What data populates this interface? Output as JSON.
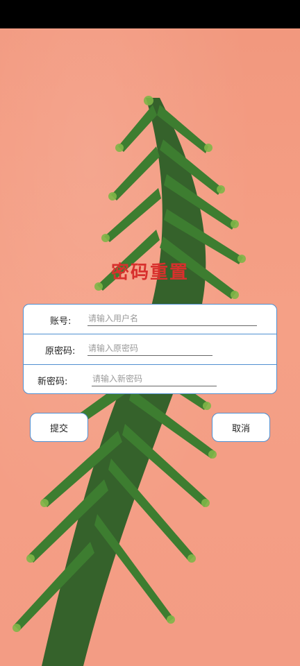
{
  "page": {
    "title": "密码重置"
  },
  "form": {
    "account": {
      "label": "账号:",
      "placeholder": "请输入用户名",
      "value": ""
    },
    "old_password": {
      "label": "原密码:",
      "placeholder": "请输入原密码",
      "value": ""
    },
    "new_password": {
      "label": "新密码:",
      "placeholder": "请输入新密码",
      "value": ""
    }
  },
  "actions": {
    "submit_label": "提交",
    "cancel_label": "取消"
  },
  "theme": {
    "background": "#f5a086",
    "title_color": "#d8302d",
    "border_color": "#4f8fd0"
  }
}
